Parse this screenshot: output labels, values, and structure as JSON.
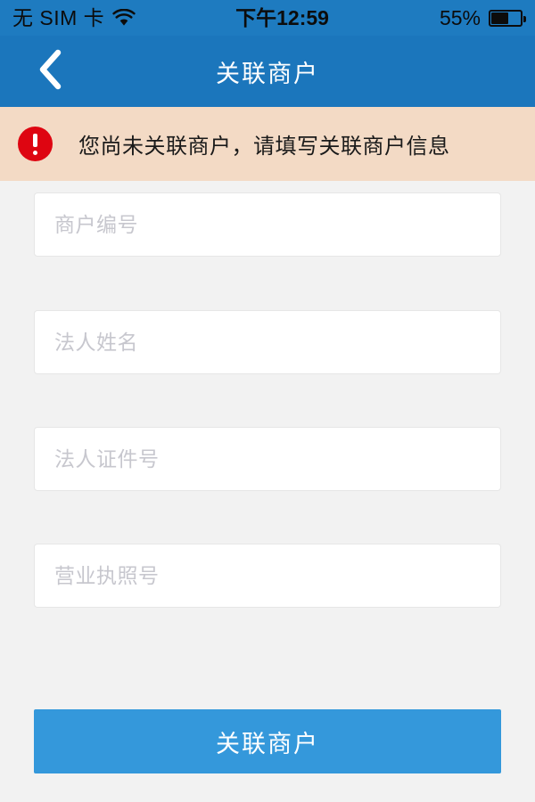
{
  "status_bar": {
    "carrier": "无 SIM 卡",
    "wifi_icon": "wifi-icon",
    "time": "下午12:59",
    "battery_percent": "55%",
    "battery_level": 55,
    "background_color": "#1e7bc0",
    "text_color": "#0c0c0c"
  },
  "nav_bar": {
    "back_icon": "chevron-left-icon",
    "title": "关联商户",
    "background_color": "#1b76bc",
    "title_color": "#ffffff"
  },
  "alert": {
    "icon": "error-exclamation-icon",
    "message": "您尚未关联商户，请填写关联商户信息",
    "background_color": "#f3dac5",
    "icon_color": "#de0511",
    "text_color": "#1a1a1a"
  },
  "form": {
    "background_color": "#f2f2f2",
    "fields": [
      {
        "name": "merchant-number",
        "placeholder": "商户编号",
        "value": ""
      },
      {
        "name": "legal-person-name",
        "placeholder": "法人姓名",
        "value": ""
      },
      {
        "name": "legal-person-id-number",
        "placeholder": "法人证件号",
        "value": ""
      },
      {
        "name": "business-license-number",
        "placeholder": "营业执照号",
        "value": ""
      }
    ],
    "placeholder_color": "#c7c7ce",
    "field_background_color": "#ffffff",
    "field_border_color": "#e6e6e6"
  },
  "submit": {
    "label": "关联商户",
    "background_color": "#3498db",
    "text_color": "#ffffff"
  }
}
